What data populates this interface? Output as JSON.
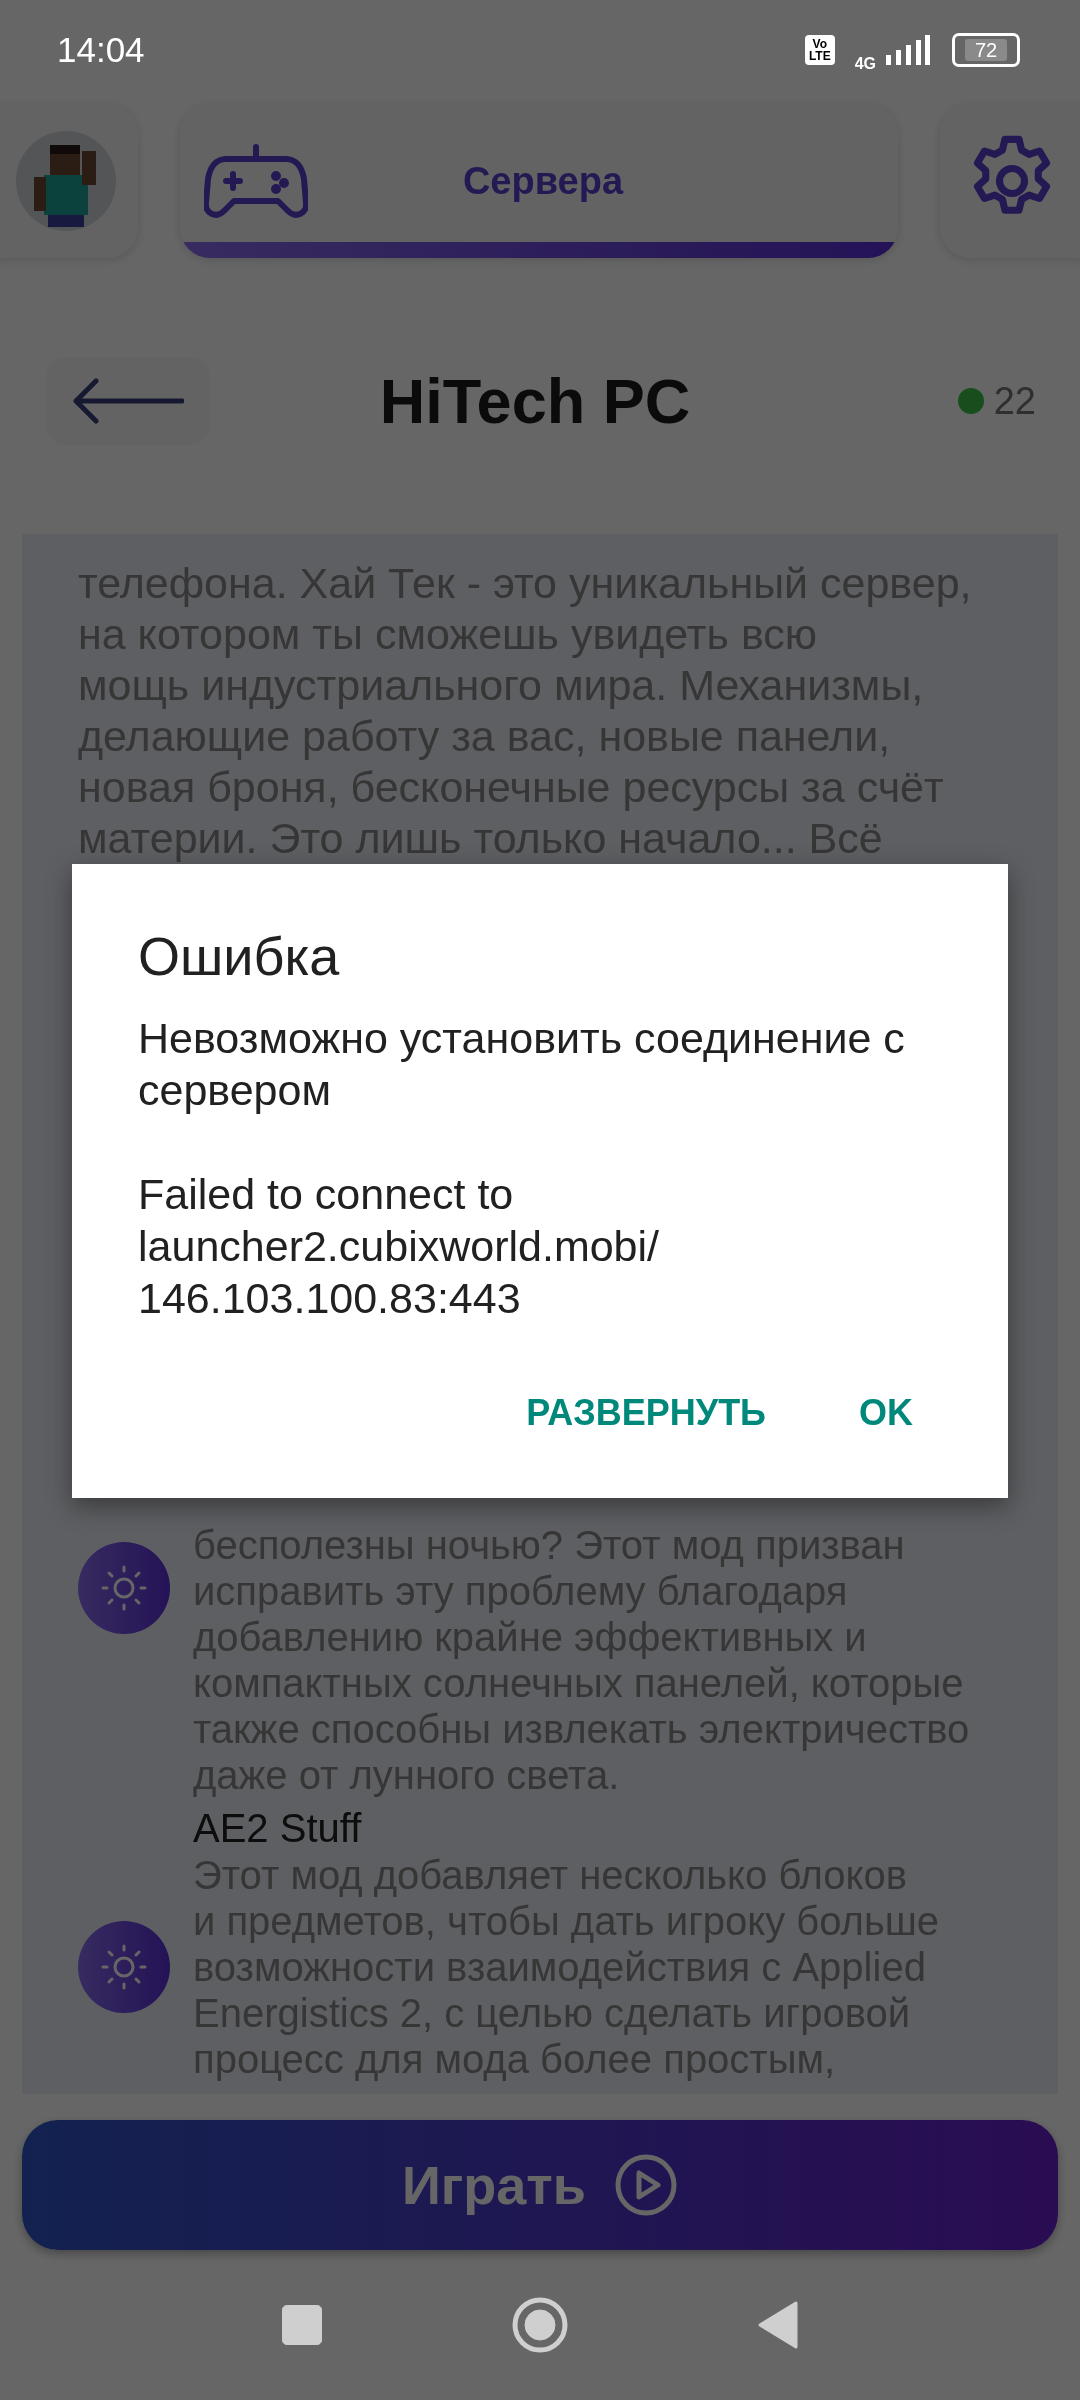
{
  "status_bar": {
    "time": "14:04",
    "volte_top": "Vo",
    "volte_bottom": "LTE",
    "network": "4G",
    "battery": "72"
  },
  "top_nav": {
    "tab": {
      "label": "Сервера",
      "selected": true
    }
  },
  "header": {
    "title": "HiTech PC",
    "online": "22"
  },
  "description": {
    "lines": [
      "телефона. Хай Тек - это уникальный сервер,",
      "на котором ты сможешь увидеть всю",
      "мощь индустриального мира. Механизмы,",
      "делающие работу за вас, новые панели,",
      "новая броня, бесконечные ресурсы за счёт",
      "материи. Это лишь только начало... Всё"
    ]
  },
  "mods": [
    {
      "lines": [
        "бесполезны ночью? Этот мод призван",
        "исправить эту проблему благодаря",
        "добавлению крайне эффективных и",
        "компактных солнечных панелей, которые",
        "также способны извлекать электричество",
        "даже от лунного света."
      ]
    },
    {
      "title": "AE2 Stuff",
      "lines": [
        "Этот мод добавляет несколько блоков",
        "и предметов, чтобы дать игроку больше",
        "возможности взаимодействия с Applied",
        "Energistics 2, с целью сделать игровой",
        "процесс для мода более простым,"
      ]
    }
  ],
  "play_button": {
    "label": "Играть"
  },
  "dialog": {
    "title": "Ошибка",
    "message": [
      "Невозможно установить соединение с",
      "сервером"
    ],
    "details": [
      "Failed to connect to",
      "launcher2.cubixworld.mobi/",
      "146.103.100.83:443"
    ],
    "buttons": [
      "РАЗВЕРНУТЬ",
      "OK"
    ]
  }
}
